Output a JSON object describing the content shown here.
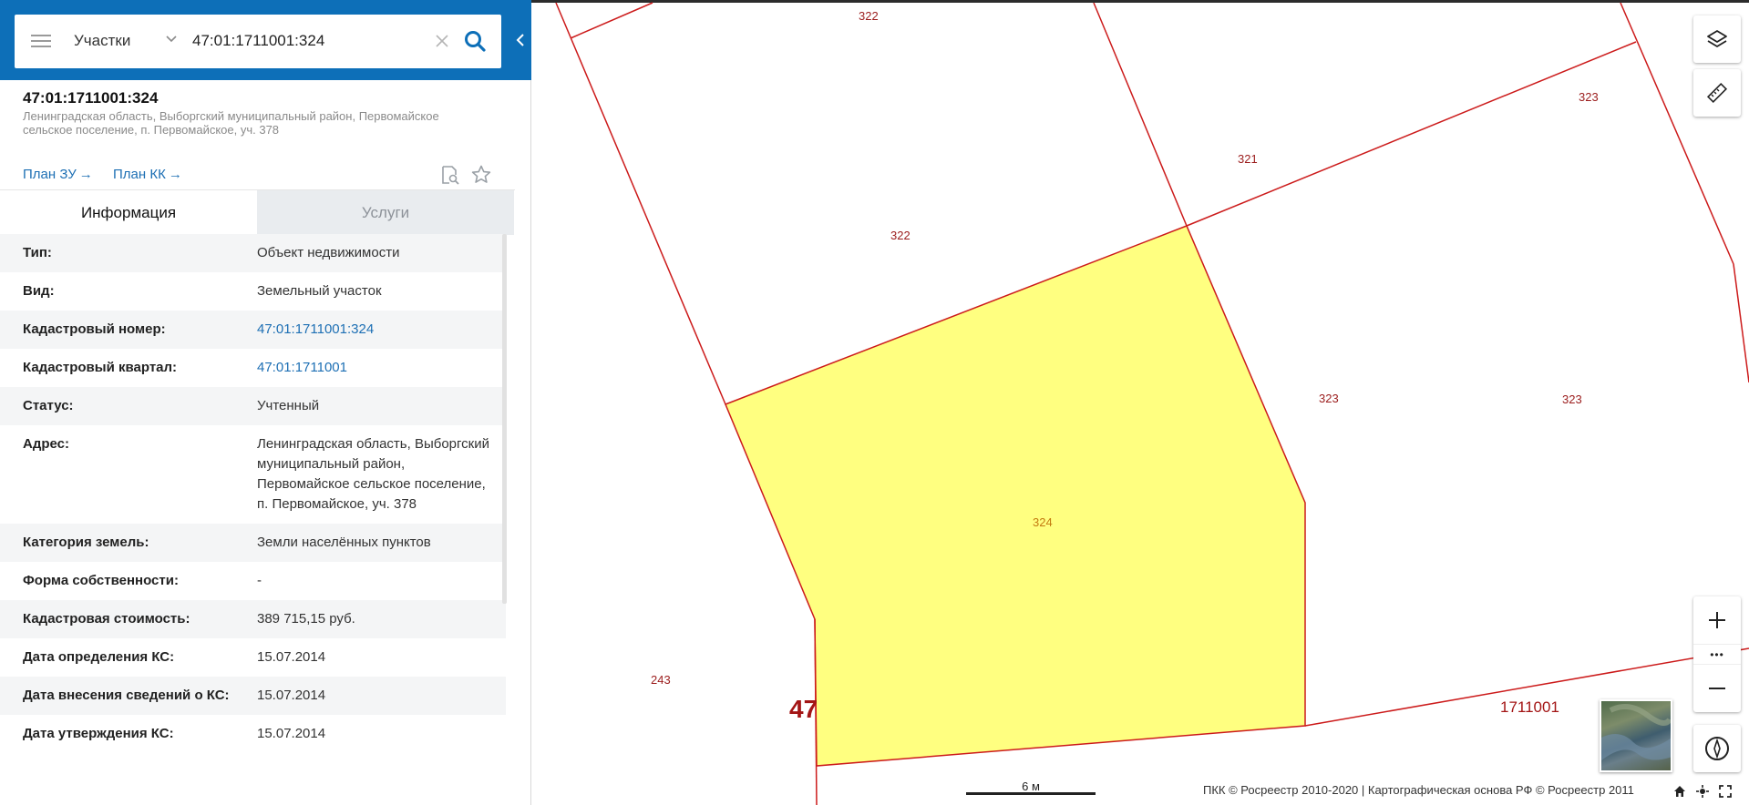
{
  "search": {
    "category": "Участки",
    "query": "47:01:1711001:324"
  },
  "object": {
    "title": "47:01:1711001:324",
    "address": "Ленинградская область, Выборгский муниципальный район, Первомайское сельское поселение, п. Первомайское, уч. 378",
    "plan_zu": "План ЗУ",
    "plan_kk": "План КК",
    "arrow": "→"
  },
  "tabs": [
    {
      "label": "Информация"
    },
    {
      "label": "Услуги"
    }
  ],
  "info": [
    {
      "label": "Тип:",
      "value": "Объект недвижимости"
    },
    {
      "label": "Вид:",
      "value": "Земельный участок"
    },
    {
      "label": "Кадастровый номер:",
      "value": "47:01:1711001:324"
    },
    {
      "label": "Кадастровый квартал:",
      "value": "47:01:1711001"
    },
    {
      "label": "Статус:",
      "value": "Учтенный"
    },
    {
      "label": "Адрес:",
      "value": "Ленинградская область, Выборгский муниципальный район, Первомайское сельское поселение, п. Первомайское, уч. 378"
    },
    {
      "label": "Категория земель:",
      "value": "Земли населённых пунктов"
    },
    {
      "label": "Форма собственности:",
      "value": "-"
    },
    {
      "label": "Кадастровая стоимость:",
      "value": "389 715,15 руб."
    },
    {
      "label": "Дата определения КС:",
      "value": "15.07.2014"
    },
    {
      "label": "Дата внесения сведений о КС:",
      "value": "15.07.2014"
    },
    {
      "label": "Дата утверждения КС:",
      "value": "15.07.2014"
    }
  ],
  "map": {
    "parcel_labels": [
      "322",
      "322",
      "321",
      "323",
      "323",
      "323",
      "324",
      "243"
    ],
    "region_code": "47",
    "quarter_label": "1711001",
    "highlight_color": "#ffff80",
    "boundary_color": "#cc1b1b"
  },
  "map_controls": {
    "zoom_dots": "•••"
  },
  "scale": {
    "label": "6 м"
  },
  "attribution": "ПКК © Росреестр 2010-2020 | Картографическая основа РФ © Росреестр 2011",
  "colors": {
    "header": "#0d6fb8",
    "link": "#1d6fb4"
  }
}
